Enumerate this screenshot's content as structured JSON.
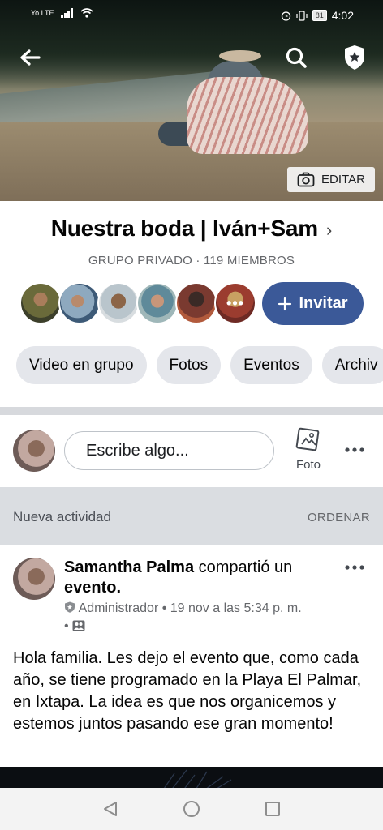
{
  "status_bar": {
    "network": "Yo LTE",
    "battery": "81",
    "time": "4:02"
  },
  "header": {
    "edit_label": "EDITAR"
  },
  "group": {
    "title": "Nuestra boda | Iván+Sam",
    "subtitle": "GRUPO PRIVADO · 119 MIEMBROS",
    "invite_label": "Invitar",
    "more_members": "•••"
  },
  "chips": [
    {
      "label": "Video en grupo"
    },
    {
      "label": "Fotos"
    },
    {
      "label": "Eventos"
    },
    {
      "label": "Archiv"
    }
  ],
  "composer": {
    "placeholder": "Escribe algo...",
    "photo_label": "Foto"
  },
  "activity": {
    "title": "Nueva actividad",
    "sort_label": "ORDENAR"
  },
  "post": {
    "author": "Samantha Palma",
    "action": " compartió un",
    "action_object": "evento.",
    "role": "Administrador",
    "timestamp": "19 nov a las 5:34 p. m.",
    "body": "Hola familia. Les dejo el evento que, como cada año, se tiene programado en la Playa El Palmar, en Ixtapa. La idea es que nos organicemos y estemos juntos pasando ese gran momento!"
  },
  "icons": {
    "back": "arrow-left-icon",
    "search": "search-icon",
    "shield": "shield-star-icon",
    "camera": "camera-icon",
    "photo": "photo-icon",
    "more": "ellipsis-icon"
  },
  "colors": {
    "accent": "#3b5998",
    "chip_bg": "#e4e6eb",
    "section_bg": "#dadde1"
  }
}
